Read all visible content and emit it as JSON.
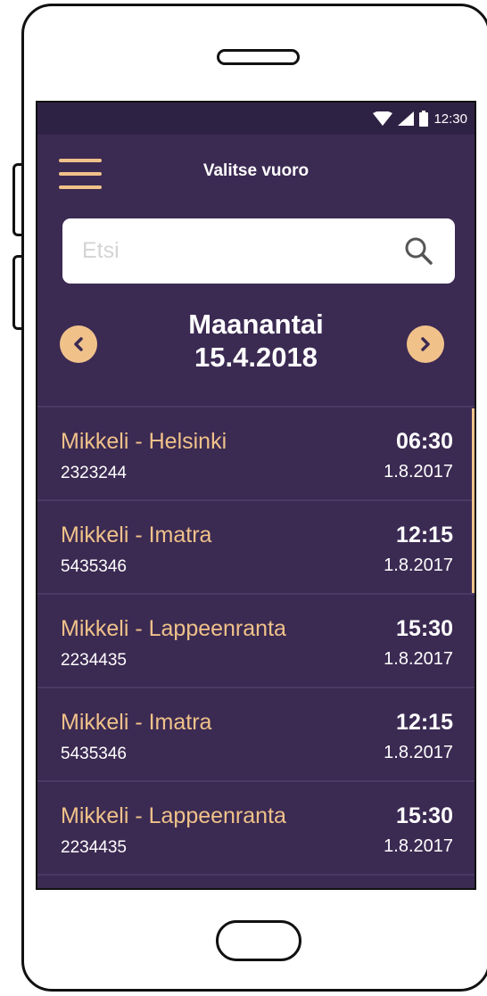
{
  "status_bar": {
    "time": "12:30"
  },
  "app_bar": {
    "title": "Valitse vuoro",
    "menu_icon": "hamburger-icon"
  },
  "search": {
    "placeholder": "Etsi",
    "value": ""
  },
  "date_nav": {
    "day": "Maanantai",
    "date": "15.4.2018"
  },
  "routes": [
    {
      "name": "Mikkeli - Helsinki",
      "code": "2323244",
      "time": "06:30",
      "date": "1.8.2017"
    },
    {
      "name": "Mikkeli - Imatra",
      "code": "5435346",
      "time": "12:15",
      "date": "1.8.2017"
    },
    {
      "name": "Mikkeli - Lappeenranta",
      "code": "2234435",
      "time": "15:30",
      "date": "1.8.2017"
    },
    {
      "name": "Mikkeli - Imatra",
      "code": "5435346",
      "time": "12:15",
      "date": "1.8.2017"
    },
    {
      "name": "Mikkeli - Lappeenranta",
      "code": "2234435",
      "time": "15:30",
      "date": "1.8.2017"
    }
  ],
  "colors": {
    "background": "#3b2a52",
    "accent": "#f0c28a",
    "status_bar": "#2e2244"
  }
}
